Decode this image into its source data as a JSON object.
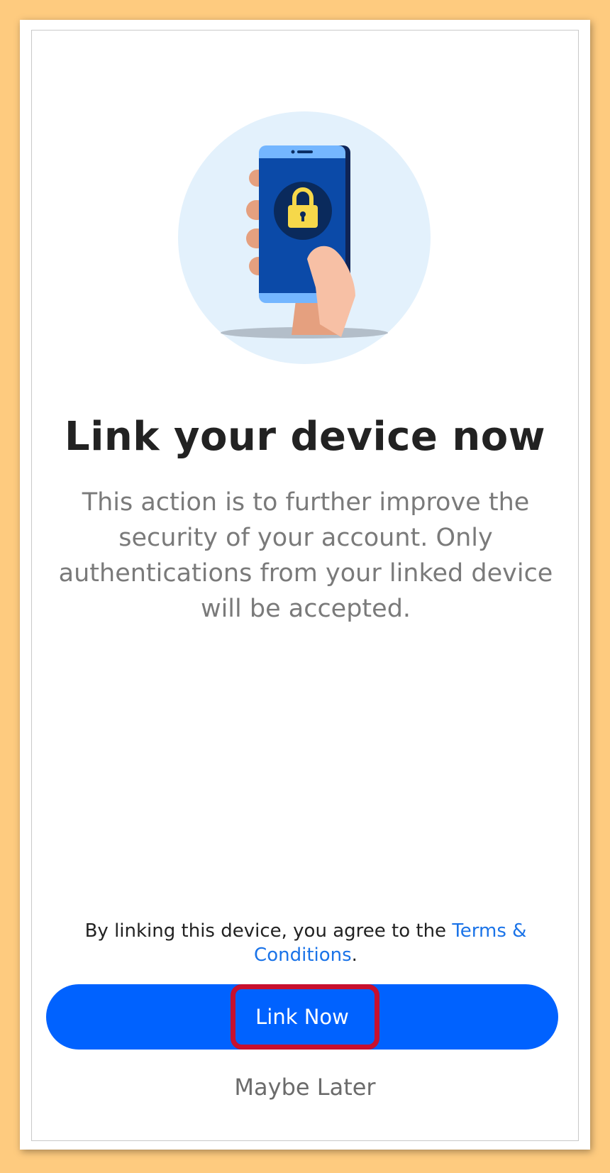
{
  "page": {
    "title": "Link your device now",
    "description": "This action is to further improve the security of your account. Only authentications from your linked device will be accepted.",
    "terms": {
      "prefix": "By linking this device, you agree to the ",
      "link_text": "Terms & Conditions",
      "suffix": "."
    },
    "primary_button_label": "Link Now",
    "secondary_button_label": "Maybe Later"
  },
  "icons": {
    "hero": "phone-lock-illustration",
    "lock": "padlock-icon"
  },
  "colors": {
    "background": "#fecb7f",
    "primary": "#0062ff",
    "link": "#1a73e8",
    "highlight": "#c8102e",
    "hero_circle": "#e3f1fc"
  }
}
